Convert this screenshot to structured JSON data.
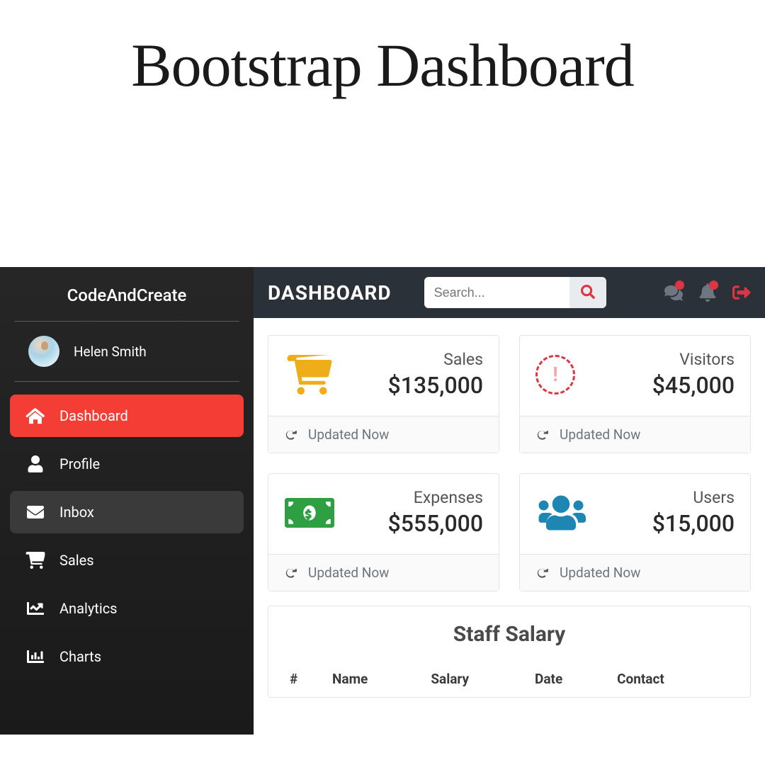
{
  "page_heading": "Bootstrap Dashboard",
  "sidebar": {
    "brand": "CodeAndCreate",
    "user_name": "Helen Smith",
    "items": [
      {
        "label": "Dashboard",
        "icon": "home",
        "state": "active"
      },
      {
        "label": "Profile",
        "icon": "user",
        "state": ""
      },
      {
        "label": "Inbox",
        "icon": "envelope",
        "state": "hover"
      },
      {
        "label": "Sales",
        "icon": "cart",
        "state": ""
      },
      {
        "label": "Analytics",
        "icon": "chart-line",
        "state": ""
      },
      {
        "label": "Charts",
        "icon": "chart-bar",
        "state": ""
      }
    ]
  },
  "topbar": {
    "title": "DASHBOARD",
    "search_placeholder": "Search...",
    "icons": [
      "comments",
      "bell",
      "logout"
    ]
  },
  "cards": [
    {
      "icon": "cart",
      "color": "#f0ad1a",
      "label": "Sales",
      "value": "$135,000",
      "footer": "Updated Now"
    },
    {
      "icon": "spinner",
      "color": "#dc3545",
      "label": "Visitors",
      "value": "$45,000",
      "footer": "Updated Now"
    },
    {
      "icon": "money",
      "color": "#2ea043",
      "label": "Expenses",
      "value": "$555,000",
      "footer": "Updated Now"
    },
    {
      "icon": "users",
      "color": "#1d86b3",
      "label": "Users",
      "value": "$15,000",
      "footer": "Updated Now"
    }
  ],
  "table": {
    "title": "Staff Salary",
    "columns": [
      "#",
      "Name",
      "Salary",
      "Date",
      "Contact"
    ]
  }
}
